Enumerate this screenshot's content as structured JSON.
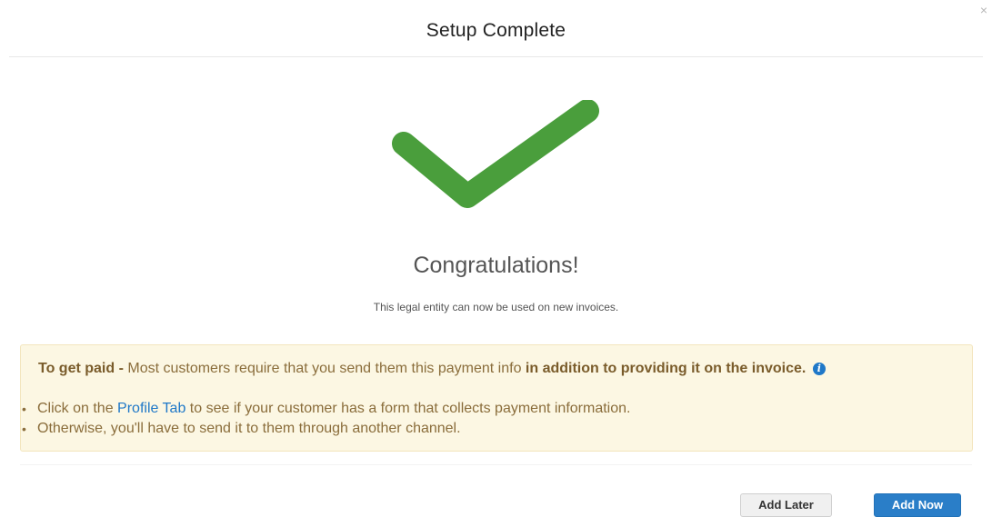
{
  "modal": {
    "title": "Setup Complete",
    "close_glyph": "×"
  },
  "success": {
    "icon": "checkmark-icon",
    "icon_color": "#4a9e3c",
    "headline": "Congratulations!",
    "subtext": "This legal entity can now be used on new invoices."
  },
  "notice": {
    "lead_bold": "To get paid -",
    "lead_text": " Most customers require that you send them this payment info ",
    "lead_bold_2": "in addition to providing it on the invoice.",
    "info_icon_glyph": "i",
    "items": [
      {
        "prefix": "Click on the ",
        "link": "Profile Tab",
        "suffix": " to see if your customer has a form that collects payment information."
      },
      {
        "text": "Otherwise, you'll have to send it to them through another channel."
      }
    ],
    "bullet_glyph": "•",
    "background": "#fcf7e3",
    "text_color": "#8a6d3b",
    "link_color": "#1f78c8"
  },
  "footer": {
    "secondary_label": "Add Later",
    "primary_label": "Add Now",
    "primary_color": "#2a7ec8"
  }
}
